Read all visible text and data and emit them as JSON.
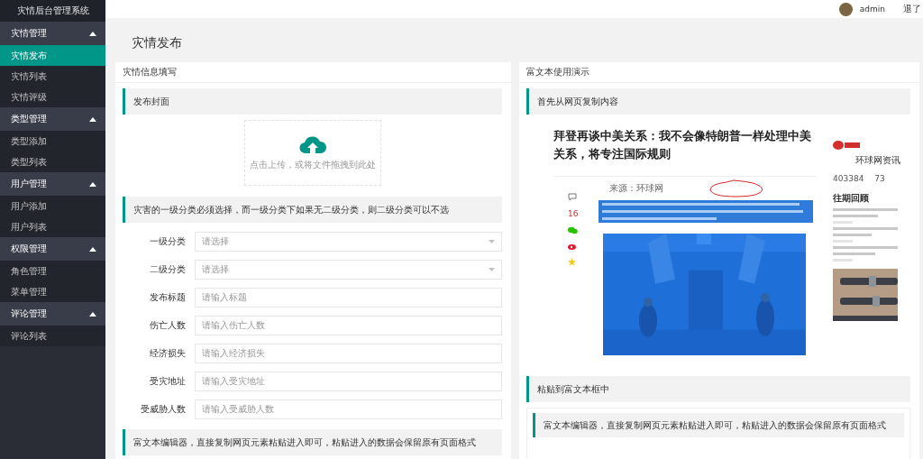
{
  "app": {
    "title": "灾情后台管理系统"
  },
  "sidebar": {
    "groups": [
      {
        "label": "灾情管理",
        "expanded": true,
        "items": [
          {
            "label": "灾情发布",
            "selected": true
          },
          {
            "label": "灾情列表",
            "selected": false
          },
          {
            "label": "灾情评级",
            "selected": false
          }
        ]
      },
      {
        "label": "类型管理",
        "expanded": true,
        "items": [
          {
            "label": "类型添加",
            "selected": false
          },
          {
            "label": "类型列表",
            "selected": false
          }
        ]
      },
      {
        "label": "用户管理",
        "expanded": true,
        "items": [
          {
            "label": "用户添加",
            "selected": false
          },
          {
            "label": "用户列表",
            "selected": false
          }
        ]
      },
      {
        "label": "权限管理",
        "expanded": true,
        "items": [
          {
            "label": "角色管理",
            "selected": false
          },
          {
            "label": "菜单管理",
            "selected": false
          }
        ]
      },
      {
        "label": "评论管理",
        "expanded": true,
        "items": [
          {
            "label": "评论列表",
            "selected": false
          }
        ]
      }
    ]
  },
  "header": {
    "user": "admin",
    "logout": "退了"
  },
  "page_title": "灾情发布",
  "form_card": {
    "title": "灾情信息填写",
    "cover_section": "发布封面",
    "upload_hint": "点击上传，或将文件拖拽到此处",
    "category_note": "灾害的一级分类必须选择，而一级分类下如果无二级分类，则二级分类可以不选",
    "fields": [
      {
        "label": "一级分类",
        "kind": "select",
        "placeholder": "请选择"
      },
      {
        "label": "二级分类",
        "kind": "select",
        "placeholder": "请选择"
      },
      {
        "label": "发布标题",
        "kind": "text",
        "placeholder": "请输入标题"
      },
      {
        "label": "伤亡人数",
        "kind": "text",
        "placeholder": "请输入伤亡人数"
      },
      {
        "label": "经济损失",
        "kind": "text",
        "placeholder": "请输入经济损失"
      },
      {
        "label": "受灾地址",
        "kind": "text",
        "placeholder": "请输入受灾地址"
      },
      {
        "label": "受威胁人数",
        "kind": "text",
        "placeholder": "请输入受威胁人数"
      }
    ],
    "editor_note": "富文本编辑器，直接复制网页元素粘贴进入即可，粘贴进入的数据会保留原有页面格式"
  },
  "demo_card": {
    "title": "富文本使用演示",
    "step_1": "首先从网页复制内容",
    "article": {
      "headline": "拜登再谈中美关系：我不会像特朗普一样处理中美关系，将专注国际规则",
      "source": "来源：环球网",
      "like_count": "16",
      "channel": "环球网资讯",
      "stats": [
        "403384",
        "73"
      ],
      "sidebar_heading": "往期回顾"
    },
    "step_2": "粘贴到富文本框中",
    "editor_note": "富文本编辑器，直接复制网页元素粘贴进入即可，粘贴进入的数据会保留原有页面格式"
  }
}
